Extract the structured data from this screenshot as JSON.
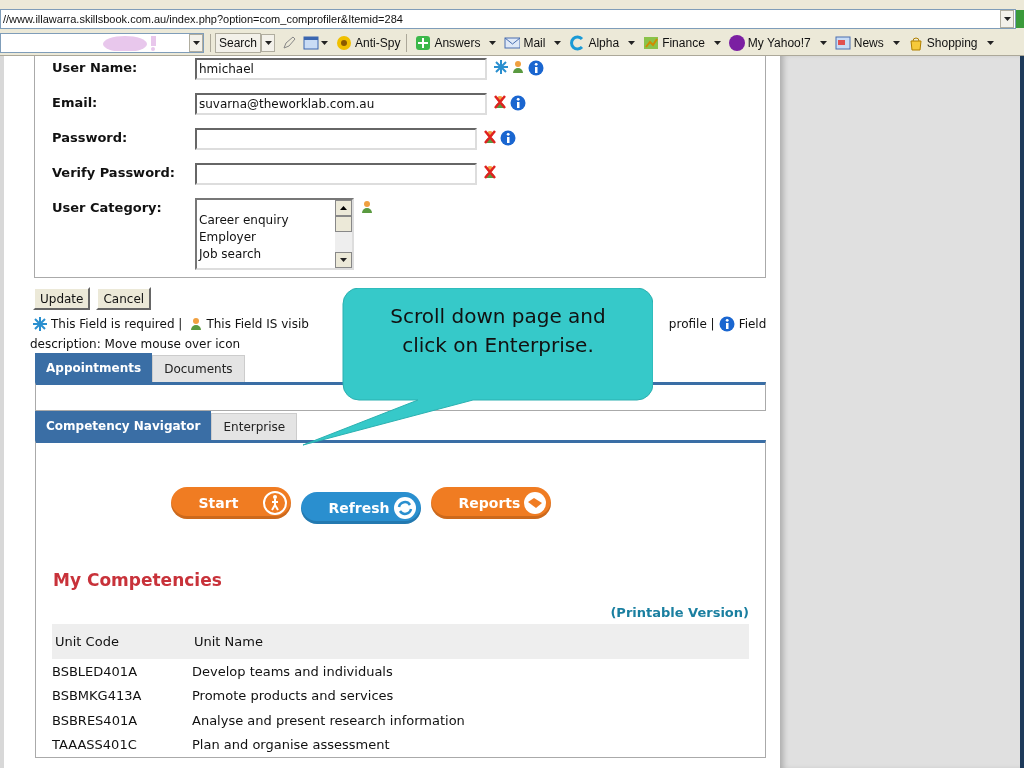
{
  "browser": {
    "address": "//www.illawarra.skillsbook.com.au/index.php?option=com_comprofiler&Itemid=284",
    "toolbar": [
      {
        "label": "Search",
        "dropdown": true
      },
      {
        "label": "Anti-Spy",
        "dropdown": false
      },
      {
        "label": "Answers",
        "dropdown": true
      },
      {
        "label": "Mail",
        "dropdown": true
      },
      {
        "label": "Alpha",
        "dropdown": true
      },
      {
        "label": "Finance",
        "dropdown": true
      },
      {
        "label": "My Yahoo!7",
        "dropdown": true
      },
      {
        "label": "News",
        "dropdown": true
      },
      {
        "label": "Shopping",
        "dropdown": true
      }
    ]
  },
  "form": {
    "fields": [
      {
        "label": "User Name:",
        "kind": "text",
        "value": "hmichael",
        "required": true,
        "visible": true,
        "info": true
      },
      {
        "label": "Email:",
        "kind": "text",
        "value": "suvarna@theworklab.com.au",
        "required": false,
        "visible": false,
        "info": true
      },
      {
        "label": "Password:",
        "kind": "password",
        "required": false,
        "visible": false,
        "info": true
      },
      {
        "label": "Verify Password:",
        "kind": "password",
        "required": false,
        "visible": false,
        "info": false
      },
      {
        "label": "User Category:",
        "kind": "listbox",
        "options": [
          "Career enquiry",
          "Employer",
          "Job search"
        ],
        "required": false,
        "visible": true,
        "info": false
      }
    ],
    "buttons": [
      "Update",
      "Cancel"
    ],
    "legend": {
      "required": "This Field is required |",
      "visible": "This Field IS visib",
      "profile": "profile |",
      "info_line1": "Field",
      "info_line2": "description: Move mouse over icon"
    }
  },
  "tabs1": [
    {
      "label": "Appointments",
      "selected": true
    },
    {
      "label": "Documents",
      "selected": false
    }
  ],
  "tabs2": [
    {
      "label": "Competency Navigator",
      "selected": true
    },
    {
      "label": "Enterprise",
      "selected": false
    }
  ],
  "callout": "Scroll down page and click on Enterprise.",
  "actions": [
    {
      "label": "Start",
      "color": "#f07c22"
    },
    {
      "label": "Refresh",
      "color": "#2a8fcf"
    },
    {
      "label": "Reports",
      "color": "#f07c22"
    }
  ],
  "competencies": {
    "title": "My Competencies",
    "printable": "(Printable Version)",
    "columns": [
      "Unit Code",
      "Unit Name"
    ],
    "rows": [
      [
        "BSBLED401A",
        "Develop teams and individuals"
      ],
      [
        "BSBMKG413A",
        "Promote products and services"
      ],
      [
        "BSBRES401A",
        "Analyse and present research information"
      ],
      [
        "TAAASS401C",
        "Plan and organise assessment"
      ]
    ]
  }
}
